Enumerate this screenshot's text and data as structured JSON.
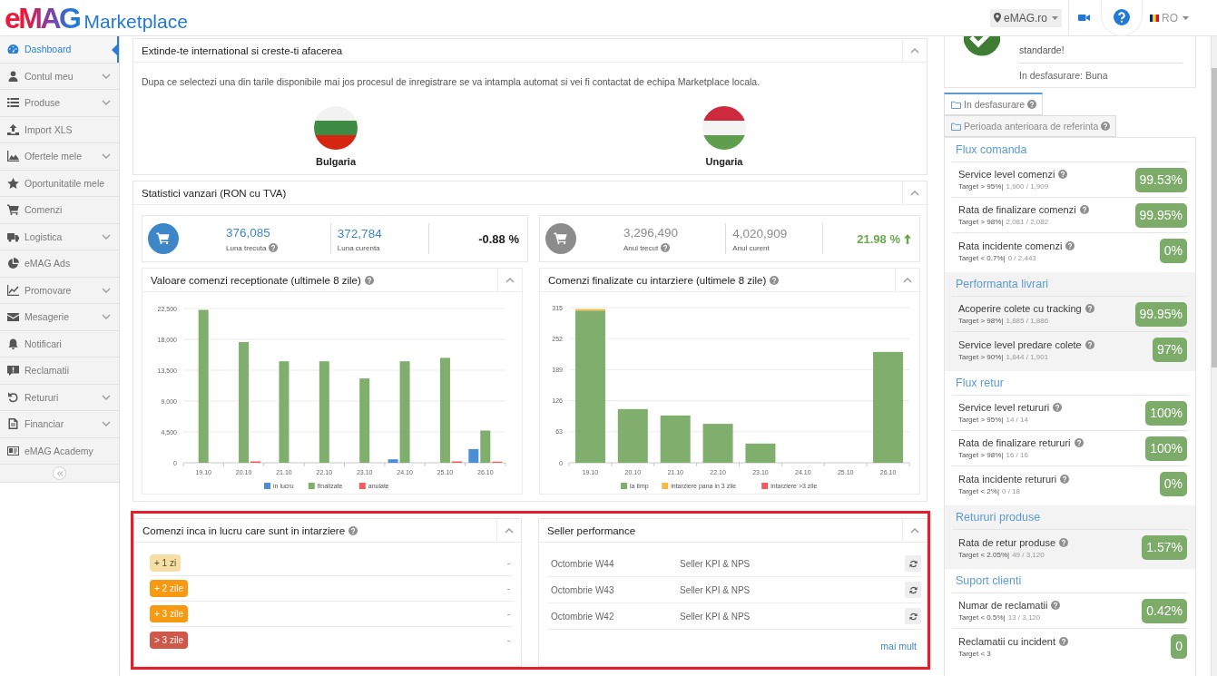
{
  "header": {
    "logo": {
      "brand": "eMAG",
      "product": "Marketplace"
    },
    "site_selector": "eMAG.ro",
    "language": "RO"
  },
  "sidebar": {
    "items": [
      {
        "label": "Dashboard",
        "selected": true,
        "has_submenu": false
      },
      {
        "label": "Contul meu",
        "selected": false,
        "has_submenu": true
      },
      {
        "label": "Produse",
        "selected": false,
        "has_submenu": true
      },
      {
        "label": "Import XLS",
        "selected": false,
        "has_submenu": false
      },
      {
        "label": "Ofertele mele",
        "selected": false,
        "has_submenu": true
      },
      {
        "label": "Oportunitatile mele",
        "selected": false,
        "has_submenu": false
      },
      {
        "label": "Comenzi",
        "selected": false,
        "has_submenu": false
      },
      {
        "label": "Logistica",
        "selected": false,
        "has_submenu": true
      },
      {
        "label": "eMAG Ads",
        "selected": false,
        "has_submenu": false
      },
      {
        "label": "Promovare",
        "selected": false,
        "has_submenu": true
      },
      {
        "label": "Mesagerie",
        "selected": false,
        "has_submenu": true
      },
      {
        "label": "Notificari",
        "selected": false,
        "has_submenu": false
      },
      {
        "label": "Reclamatii",
        "selected": false,
        "has_submenu": false
      },
      {
        "label": "Retururi",
        "selected": false,
        "has_submenu": true
      },
      {
        "label": "Financiar",
        "selected": false,
        "has_submenu": true
      },
      {
        "label": "eMAG Academy",
        "selected": false,
        "has_submenu": false
      }
    ]
  },
  "international": {
    "title": "Extinde-te international si creste-ti afacerea",
    "expanded": true,
    "description": "Dupa ce selectezi una din tarile disponibile mai jos procesul de inregistrare se va intampla automat si vei fi contactat de echipa Marketplace locala.",
    "countries": [
      {
        "name": "Bulgaria"
      },
      {
        "name": "Ungaria"
      }
    ]
  },
  "sales_stats": {
    "title": "Statistici vanzari (RON cu TVA)",
    "expanded": true,
    "summaries": [
      {
        "color": "#3d86c8",
        "previous": {
          "value": "376,085",
          "label": "Luna trecuta",
          "help": true
        },
        "current": {
          "value": "372,784",
          "label": "Luna curenta",
          "help": false
        },
        "change": "-0.88 %",
        "rising": false
      },
      {
        "color": "#8c8c8c",
        "previous": {
          "value": "3,296,490",
          "label": "Anul trecut",
          "help": true
        },
        "current": {
          "value": "4,020,909",
          "label": "Anul curent",
          "help": false
        },
        "change": "21.98 %",
        "rising": true
      }
    ],
    "charts": [
      {
        "title": "Valoare comenzi receptionate (ultimele 8 zile)",
        "help": true,
        "expanded": true,
        "chart_data": {
          "type": "bar",
          "categories": [
            "19.10",
            "20.10",
            "21.10",
            "22.10",
            "23.10",
            "24.10",
            "25.10",
            "26.10"
          ],
          "series": [
            {
              "name": "in lucru",
              "color": "#4a8fd6",
              "values": [
                0,
                0,
                0,
                0,
                0,
                500,
                0,
                2000
              ]
            },
            {
              "name": "finalizate",
              "color": "#7fae6d",
              "values": [
                22300,
                17600,
                14800,
                14800,
                12300,
                14800,
                15300,
                4700
              ]
            },
            {
              "name": "anulate",
              "color": "#f25c5c",
              "values": [
                0,
                200,
                0,
                0,
                0,
                0,
                200,
                100
              ]
            }
          ],
          "ylim": [
            0,
            22500
          ],
          "yticks": [
            {
              "value": 0,
              "label": "0"
            },
            {
              "value": 4500,
              "label": "4,500"
            },
            {
              "value": 9000,
              "label": "9,000"
            },
            {
              "value": 13500,
              "label": "13,500"
            },
            {
              "value": 18000,
              "label": "18,000"
            },
            {
              "value": 22500,
              "label": "22,500"
            }
          ],
          "stacked": false,
          "grid": true,
          "legend": true
        }
      },
      {
        "title": "Comenzi finalizate cu intarziere (ultimele 8 zile)",
        "help": true,
        "expanded": true,
        "chart_data": {
          "type": "bar",
          "categories": [
            "19.10",
            "20.10",
            "21.10",
            "22.10",
            "23.10",
            "24.10",
            "25.10",
            "26.10"
          ],
          "series": [
            {
              "name": "la timp",
              "color": "#7fae6d",
              "values": [
                309,
                109,
                96,
                79,
                39,
                0,
                0,
                225
              ]
            },
            {
              "name": "intarziere pana in 3 zile",
              "color": "#f7b942",
              "values": [
                3,
                0,
                0,
                0,
                0,
                0,
                0,
                0
              ]
            },
            {
              "name": "intarziere >3 zile",
              "color": "#f25c5c",
              "values": [
                0,
                0,
                0,
                0,
                0,
                0,
                0,
                0
              ]
            }
          ],
          "ylim": [
            0,
            315
          ],
          "yticks": [
            0,
            63,
            126,
            189,
            252,
            315
          ],
          "stacked": true,
          "grid": true,
          "legend": true
        }
      }
    ]
  },
  "bottom_section": {
    "highlighted": true,
    "delayed_orders": {
      "title": "Comenzi inca in lucru care sunt in intarziere",
      "help": true,
      "expanded": true,
      "rows": [
        {
          "badge": "+ 1 zi",
          "color": "#f5dfa4",
          "value": "-"
        },
        {
          "badge": "+ 2 zile",
          "color": "#f79a12",
          "value": "-"
        },
        {
          "badge": "+ 3 zile",
          "color": "#f79a12",
          "value": "-"
        },
        {
          "badge": "> 3 zile",
          "color": "#cf5849",
          "value": "-"
        }
      ]
    },
    "seller_performance": {
      "title": "Seller performance",
      "help": false,
      "expanded": true,
      "reports": [
        {
          "period": "Octombrie W44",
          "name": "Seller KPI & NPS"
        },
        {
          "period": "Octombrie W43",
          "name": "Seller KPI & NPS"
        },
        {
          "period": "Octombrie W42",
          "name": "Seller KPI & NPS"
        }
      ],
      "more_link": "mai mult"
    }
  },
  "performance": {
    "status_card": {
      "message": "standarde!",
      "status": "In desfasurare: Buna"
    },
    "tabs": [
      {
        "label": "In desfasurare",
        "selected": true,
        "help": true
      },
      {
        "label": "Perioada anterioara de referinta",
        "selected": false,
        "help": true
      }
    ],
    "sections": [
      {
        "title": "Flux comanda",
        "metrics": [
          {
            "label": "Service level comenzi",
            "help": true,
            "target": "Target > 95%|",
            "counts": "1,900 / 1,909",
            "value": "99.53%"
          },
          {
            "label": "Rata de finalizare comenzi",
            "help": true,
            "target": "Target > 98%|",
            "counts": "2,081 / 2,082",
            "value": "99.95%"
          },
          {
            "label": "Rata incidente comenzi",
            "help": true,
            "target": "Target < 0.7%|",
            "counts": "0 / 2,443",
            "value": "0%"
          }
        ]
      },
      {
        "title": "Performanta livrari",
        "metrics": [
          {
            "label": "Acoperire colete cu tracking",
            "help": true,
            "target": "Target > 98%|",
            "counts": "1,885 / 1,886",
            "value": "99.95%"
          },
          {
            "label": "Service level predare colete",
            "help": true,
            "target": "Target > 90%|",
            "counts": "1,844 / 1,901",
            "value": "97%"
          }
        ]
      },
      {
        "title": "Flux retur",
        "metrics": [
          {
            "label": "Service level retururi",
            "help": true,
            "target": "Target > 95%|",
            "counts": "14 / 14",
            "value": "100%"
          },
          {
            "label": "Rata de finalizare retururi",
            "help": true,
            "target": "Target > 98%|",
            "counts": "16 / 16",
            "value": "100%"
          },
          {
            "label": "Rata incidente retururi",
            "help": true,
            "target": "Target < 2%|",
            "counts": "0 / 18",
            "value": "0%"
          }
        ]
      },
      {
        "title": "Retururi produse",
        "metrics": [
          {
            "label": "Rata de retur produse",
            "help": true,
            "target": "Target < 2.05%|",
            "counts": "49 / 3,120",
            "value": "1.57%"
          }
        ]
      },
      {
        "title": "Suport clienti",
        "metrics": [
          {
            "label": "Numar de reclamatii",
            "help": true,
            "target": "Target < 0.5%|",
            "counts": "13 / 3,120",
            "value": "0.42%"
          },
          {
            "label": "Reclamatii cu incident",
            "help": true,
            "target": "Target < 3",
            "value": "0"
          }
        ]
      }
    ]
  }
}
